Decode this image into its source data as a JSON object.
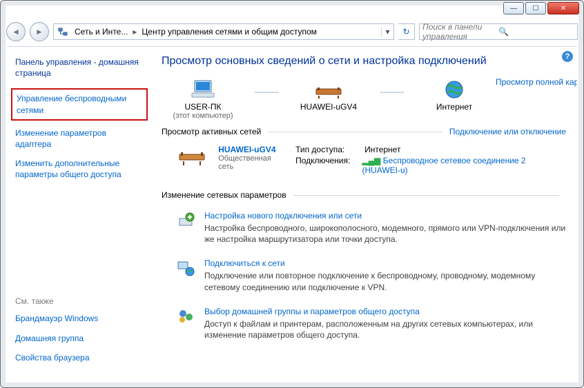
{
  "titlebar": {
    "min_glyph": "—",
    "max_glyph": "☐",
    "close_glyph": "✕"
  },
  "nav": {
    "back_glyph": "◄",
    "fwd_glyph": "►",
    "crumb1": "Сеть и Инте...",
    "crumb2": "Центр управления сетями и общим доступом",
    "arrow": "▸",
    "drop": "▾",
    "refresh": "↻",
    "search_placeholder": "Поиск в панели управления",
    "search_icon": "🔍"
  },
  "sidebar": {
    "home": "Панель управления - домашняя страница",
    "links": [
      "Управление беспроводными сетями",
      "Изменение параметров адаптера",
      "Изменить дополнительные параметры общего доступа"
    ],
    "see_also_label": "См. также",
    "see_also": [
      "Брандмауэр Windows",
      "Домашняя группа",
      "Свойства браузера"
    ]
  },
  "content": {
    "help_glyph": "?",
    "title": "Просмотр основных сведений о сети и настройка подключений",
    "full_map_link": "Просмотр полной карты",
    "map": {
      "node1": "USER-ПК",
      "node1_sub": "(этот компьютер)",
      "node2": "HUAWEI-uGV4",
      "node3": "Интернет",
      "sep": "— — —"
    },
    "active_label": "Просмотр активных сетей",
    "connect_link": "Подключение или отключение",
    "active": {
      "name": "HUAWEI-uGV4",
      "type": "Общественная сеть",
      "access_k": "Тип доступа:",
      "access_v": "Интернет",
      "conn_k": "Подключения:",
      "conn_v": "Беспроводное сетевое соединение 2 (HUAWEI-u)",
      "signal": "▂▄▆"
    },
    "change_label": "Изменение сетевых параметров",
    "tasks": [
      {
        "title": "Настройка нового подключения или сети",
        "desc": "Настройка беспроводного, широкополосного, модемного, прямого или VPN-подключения или же настройка маршрутизатора или точки доступа."
      },
      {
        "title": "Подключиться к сети",
        "desc": "Подключение или повторное подключение к беспроводному, проводному, модемному сетевому соединению или подключение к VPN."
      },
      {
        "title": "Выбор домашней группы и параметров общего доступа",
        "desc": "Доступ к файлам и принтерам, расположенным на других сетевых компьютерах, или изменение параметров общего доступа."
      }
    ]
  }
}
